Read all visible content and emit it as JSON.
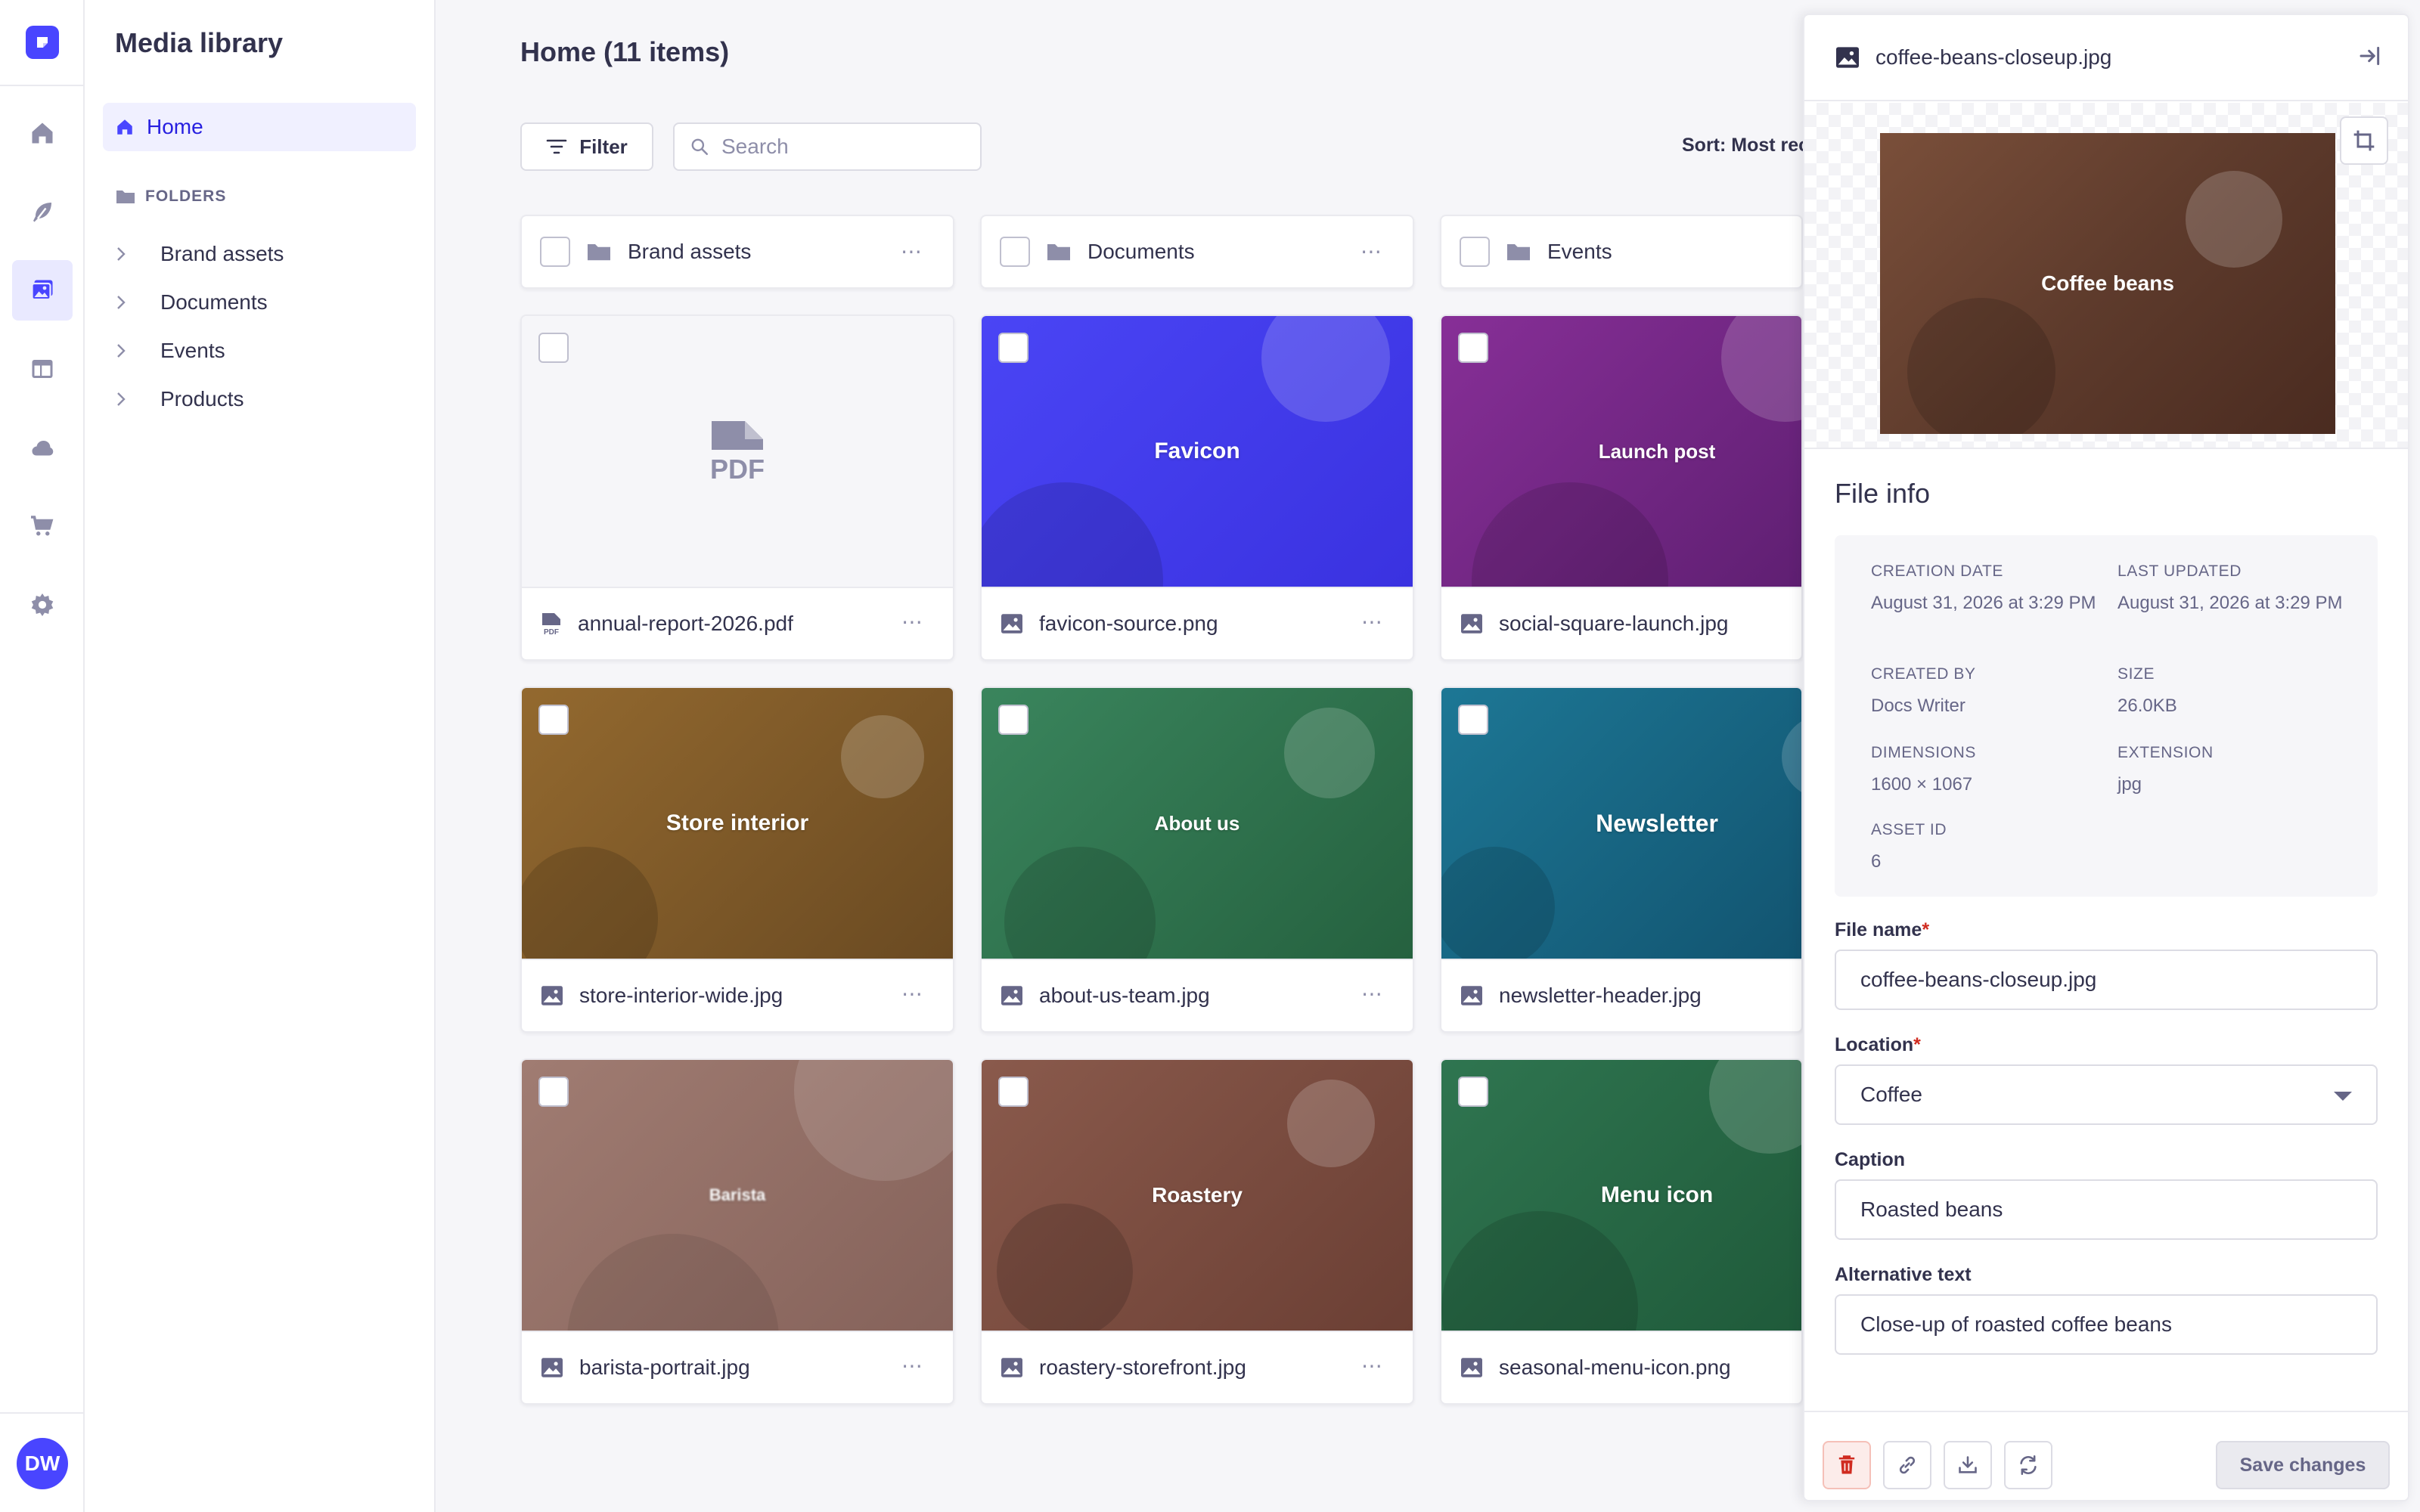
{
  "sidebar": {
    "title": "Media library",
    "home_label": "Home",
    "folders_label": "FOLDERS",
    "folders": [
      "Brand assets",
      "Documents",
      "Events",
      "Products"
    ],
    "avatar_initials": "DW"
  },
  "main": {
    "title": "Home (11 items)",
    "filter_label": "Filter",
    "search_placeholder": "Search",
    "sort_label": "Sort: Most rec",
    "folder_cards": [
      "Brand assets",
      "Documents",
      "Events"
    ],
    "assets": [
      {
        "file": "annual-report-2026.pdf",
        "thumb_label": "PDF",
        "type": "pdf",
        "color": "#f6f6f9"
      },
      {
        "file": "favicon-source.png",
        "thumb_label": "Favicon",
        "type": "image",
        "color": "#4945ff"
      },
      {
        "file": "social-square-launch.jpg",
        "thumb_label": "Launch post",
        "type": "image",
        "color": "#7b2c8f"
      },
      {
        "file": "store-interior-wide.jpg",
        "thumb_label": "Store interior",
        "type": "image",
        "color": "#8b6530"
      },
      {
        "file": "about-us-team.jpg",
        "thumb_label": "About us",
        "type": "image",
        "color": "#2f7a52"
      },
      {
        "file": "newsletter-header.jpg",
        "thumb_label": "Newsletter",
        "type": "image",
        "color": "#1a6a86"
      },
      {
        "file": "barista-portrait.jpg",
        "thumb_label": "Barista",
        "type": "image",
        "color": "#987066"
      },
      {
        "file": "roastery-storefront.jpg",
        "thumb_label": "Roastery",
        "type": "image",
        "color": "#7f4f44"
      },
      {
        "file": "seasonal-menu-icon.png",
        "thumb_label": "Menu icon",
        "type": "image",
        "color": "#2b6a45"
      }
    ]
  },
  "panel": {
    "file_name": "coffee-beans-closeup.jpg",
    "preview_label": "Coffee beans",
    "file_info_title": "File info",
    "info": {
      "creation_date_label": "CREATION DATE",
      "creation_date": "August 31, 2026 at 3:29 PM",
      "last_updated_label": "LAST UPDATED",
      "last_updated": "August 31, 2026 at 3:29 PM",
      "created_by_label": "CREATED BY",
      "created_by": "Docs Writer",
      "size_label": "SIZE",
      "size": "26.0KB",
      "dimensions_label": "DIMENSIONS",
      "dimensions": "1600 × 1067",
      "extension_label": "EXTENSION",
      "extension": "jpg",
      "asset_id_label": "ASSET ID",
      "asset_id": "6"
    },
    "form": {
      "file_name_label": "File name",
      "file_name_value": "coffee-beans-closeup.jpg",
      "location_label": "Location",
      "location_value": "Coffee",
      "caption_label": "Caption",
      "caption_value": "Roasted beans",
      "alt_label": "Alternative text",
      "alt_value": "Close-up of roasted coffee beans",
      "required_mark": "*"
    },
    "save_label": "Save changes"
  },
  "colors": {
    "accent": "#4945ff",
    "danger": "#d02b20",
    "neutral_text": "#32324d",
    "muted_text": "#666687"
  }
}
